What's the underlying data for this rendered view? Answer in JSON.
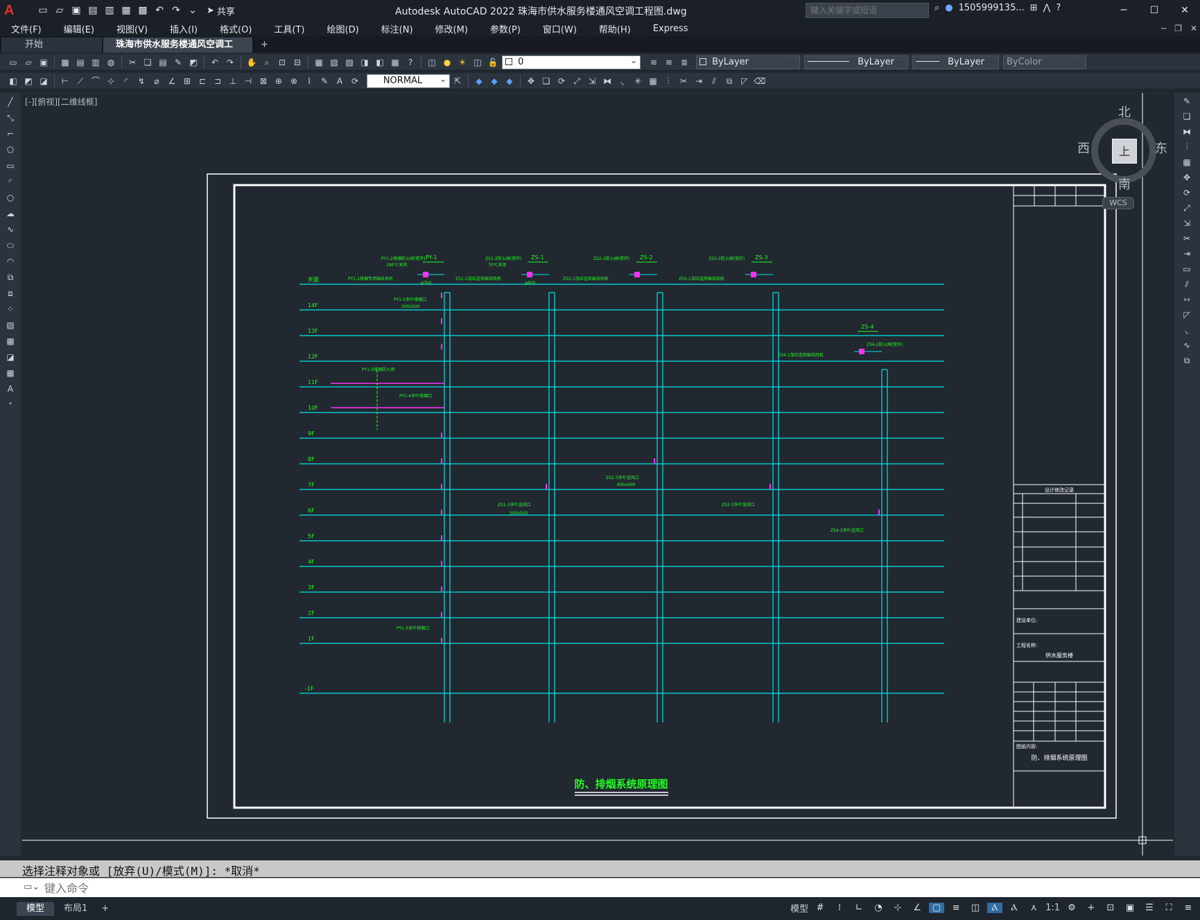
{
  "app": {
    "title": "Autodesk AutoCAD 2022    珠海市供水服务楼通风空调工程图.dwg",
    "share_label": "共享",
    "search_placeholder": "键入关键字或短语",
    "user": "1505999135...",
    "logo": "A"
  },
  "menu": [
    "文件(F)",
    "编辑(E)",
    "视图(V)",
    "插入(I)",
    "格式(O)",
    "工具(T)",
    "绘图(D)",
    "标注(N)",
    "修改(M)",
    "参数(P)",
    "窗口(W)",
    "帮助(H)",
    "Express"
  ],
  "tabs": {
    "start": "开始",
    "active": "珠海市供水服务楼通风空调工程图*"
  },
  "toolbar": {
    "layer": "0",
    "color": "ByLayer",
    "linetype": "ByLayer",
    "lineweight": "ByLayer",
    "plotstyle": "ByColor",
    "dimstyle": "NORMAL"
  },
  "viewport": {
    "label": "[-][俯视][二维线框]",
    "viewcube": {
      "north": "北",
      "south": "南",
      "east": "东",
      "west": "西",
      "face": "上",
      "wcs": "WCS"
    }
  },
  "drawing": {
    "title": "防、排烟系统原理图",
    "titleblock": {
      "revision_header": "设计修改记录",
      "build_unit_label": "建设单位:",
      "project_label": "工程名称:",
      "project_name": "供水服务楼",
      "content_label": "图纸内容:",
      "content": "防、排烟系统原理图"
    },
    "system_tags": [
      "PY-1",
      "ZS-1",
      "ZS-2",
      "ZS-3",
      "ZS-4"
    ],
    "floors": [
      "天面",
      "14F",
      "13F",
      "12F",
      "11F",
      "10F",
      "9F",
      "8F",
      "7F",
      "6F",
      "5F",
      "4F",
      "3F",
      "2F",
      "1F",
      "-1F"
    ],
    "annotations": [
      "PY1-2排烟防火阀(常开)",
      "280℃关闭",
      "PY1-1排烟专用轴流风机",
      "φ700",
      "PY1-5多叶排烟口",
      "500x500",
      "ZS1-2防火阀(常开)",
      "70℃关闭",
      "ZS1-1加压送风轴流风机",
      "φ800",
      "ZS2-2防火阀(常开)",
      "ZS2-1加压送风轴流风机",
      "ZS3-2防火阀(常开)",
      "ZS3-1加压送风轴流风机",
      "ZS4-1加压送风轴流风机",
      "ZS4-2防火阀(常开)",
      "ZS1-3多叶送风口",
      "ZS2-3多叶送风口",
      "ZS3-3多叶送风口",
      "ZS4-3多叶送风口",
      "600x600",
      "500x500",
      "PY1-3排烟防火阀",
      "PY1-4多叶排烟口",
      "PY1-3多叶排烟口"
    ]
  },
  "command": {
    "history": "选择注释对象或 [放弃(U)/模式(M)]: *取消*",
    "placeholder": "键入命令"
  },
  "status": {
    "model_tab": "模型",
    "layout_tab": "布局1",
    "model_label": "模型",
    "scale": "1:1"
  },
  "colors": {
    "cyan": "#00e5ea",
    "green": "#20ff20",
    "magenta": "#ff30ff",
    "white": "#ffffff"
  }
}
